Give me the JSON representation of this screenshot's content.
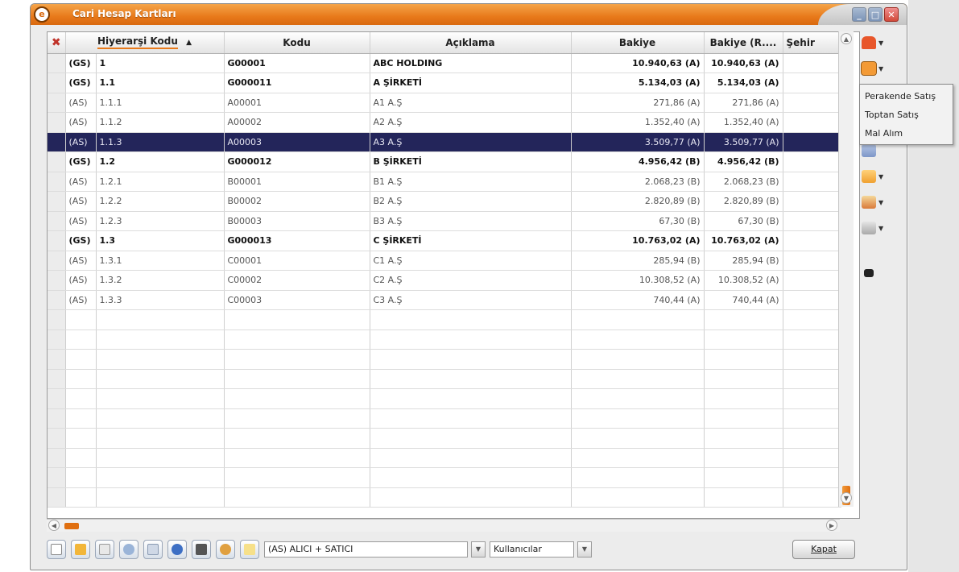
{
  "window": {
    "title": "Cari Hesap Kartları",
    "logo_glyph": "e"
  },
  "columns": {
    "hierarchy": "Hiyerarşi Kodu",
    "sort_indicator": "▲",
    "code": "Kodu",
    "description": "Açıklama",
    "balance": "Bakiye",
    "balance_r": "Bakiye (R....",
    "city": "Şehir"
  },
  "rows": [
    {
      "type": "(GS)",
      "hier": "1",
      "code": "G00001",
      "desc": "ABC HOLDING",
      "bal": "10.940,63 (A)",
      "balr": "10.940,63 (A)"
    },
    {
      "type": "(GS)",
      "hier": "1.1",
      "code": "G000011",
      "desc": "A ŞİRKETİ",
      "bal": "5.134,03 (A)",
      "balr": "5.134,03 (A)"
    },
    {
      "type": "(AS)",
      "hier": "1.1.1",
      "code": "A00001",
      "desc": "A1 A.Ş",
      "bal": "271,86 (A)",
      "balr": "271,86 (A)"
    },
    {
      "type": "(AS)",
      "hier": "1.1.2",
      "code": "A00002",
      "desc": "A2 A.Ş",
      "bal": "1.352,40 (A)",
      "balr": "1.352,40 (A)"
    },
    {
      "type": "(AS)",
      "hier": "1.1.3",
      "code": "A00003",
      "desc": "A3 A.Ş",
      "bal": "3.509,77 (A)",
      "balr": "3.509,77 (A)"
    },
    {
      "type": "(GS)",
      "hier": "1.2",
      "code": "G000012",
      "desc": "B ŞİRKETİ",
      "bal": "4.956,42 (B)",
      "balr": "4.956,42 (B)"
    },
    {
      "type": "(AS)",
      "hier": "1.2.1",
      "code": "B00001",
      "desc": "B1 A.Ş",
      "bal": "2.068,23 (B)",
      "balr": "2.068,23 (B)"
    },
    {
      "type": "(AS)",
      "hier": "1.2.2",
      "code": "B00002",
      "desc": "B2 A.Ş",
      "bal": "2.820,89 (B)",
      "balr": "2.820,89 (B)"
    },
    {
      "type": "(AS)",
      "hier": "1.2.3",
      "code": "B00003",
      "desc": "B3 A.Ş",
      "bal": "67,30 (B)",
      "balr": "67,30 (B)"
    },
    {
      "type": "(GS)",
      "hier": "1.3",
      "code": "G000013",
      "desc": "C ŞİRKETİ",
      "bal": "10.763,02 (A)",
      "balr": "10.763,02 (A)"
    },
    {
      "type": "(AS)",
      "hier": "1.3.1",
      "code": "C00001",
      "desc": "C1 A.Ş",
      "bal": "285,94 (B)",
      "balr": "285,94 (B)"
    },
    {
      "type": "(AS)",
      "hier": "1.3.2",
      "code": "C00002",
      "desc": "C2 A.Ş",
      "bal": "10.308,52 (A)",
      "balr": "10.308,52 (A)"
    },
    {
      "type": "(AS)",
      "hier": "1.3.3",
      "code": "C00003",
      "desc": "C3 A.Ş",
      "bal": "740,44 (A)",
      "balr": "740,44 (A)"
    }
  ],
  "dropdown_menu": {
    "items": [
      "Perakende Satış",
      "Toptan Satış",
      "Mal Alım"
    ]
  },
  "filters": {
    "account_type": "(AS) ALICI + SATICI",
    "users": "Kullanıcılar"
  },
  "buttons": {
    "close": "Kapat"
  },
  "colors": {
    "title_orange": "#e8791a",
    "selection_navy": "#23255a"
  }
}
